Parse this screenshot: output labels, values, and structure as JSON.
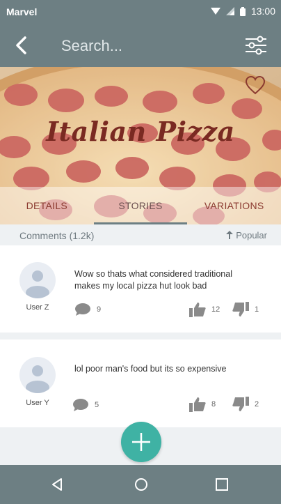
{
  "status_bar": {
    "carrier": "Marvel",
    "time": "13:00"
  },
  "app_bar": {
    "search_placeholder": "Search..."
  },
  "hero": {
    "title": "Italian Pizza"
  },
  "tabs": [
    {
      "label": "DETAILS"
    },
    {
      "label": "STORIES"
    },
    {
      "label": "VARIATIONS"
    }
  ],
  "comments": {
    "count_label": "Comments (1.2k)",
    "sort_label": "Popular",
    "items": [
      {
        "user": "User Z",
        "text": "Wow so thats what considered traditional\n makes my local pizza hut look  bad",
        "replies": "9",
        "likes": "12",
        "dislikes": "1"
      },
      {
        "user": "User Y",
        "text": "lol poor man's food but its so expensive",
        "replies": "5",
        "likes": "8",
        "dislikes": "2"
      }
    ]
  },
  "colors": {
    "app_bar": "#6d7f83",
    "fab": "#3fb2a4",
    "tab_text": "#8b3a30"
  },
  "icons": [
    "back-arrow-icon",
    "filter-sliders-icon",
    "heart-icon",
    "comment-icon",
    "thumbs-up-icon",
    "thumbs-down-icon",
    "plus-icon",
    "nav-back-icon",
    "nav-home-icon",
    "nav-recent-icon"
  ]
}
